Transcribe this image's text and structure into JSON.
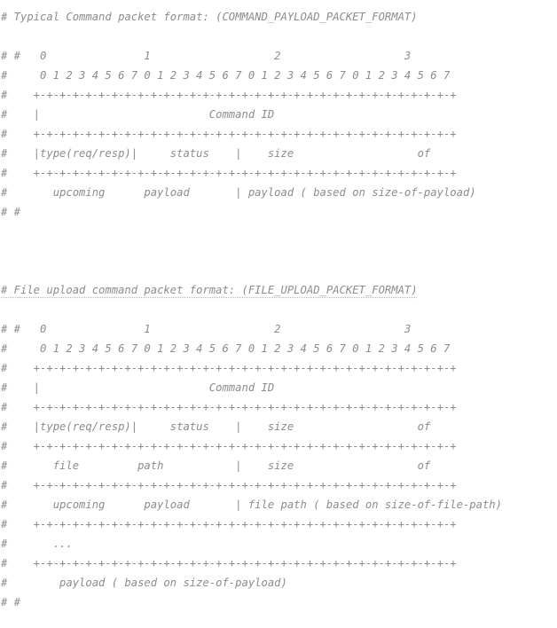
{
  "lines": [
    "# Typical Command packet format: (COMMAND_PAYLOAD_PACKET_FORMAT)",
    "",
    "# #   0               1                   2                   3",
    "#     0 1 2 3 4 5 6 7 0 1 2 3 4 5 6 7 0 1 2 3 4 5 6 7 0 1 2 3 4 5 6 7",
    "#    +-+-+-+-+-+-+-+-+-+-+-+-+-+-+-+-+-+-+-+-+-+-+-+-+-+-+-+-+-+-+-+-+",
    "#    |                          Command ID",
    "#    +-+-+-+-+-+-+-+-+-+-+-+-+-+-+-+-+-+-+-+-+-+-+-+-+-+-+-+-+-+-+-+-+",
    "#    |type(req/resp)|     status    |    size                   of",
    "#    +-+-+-+-+-+-+-+-+-+-+-+-+-+-+-+-+-+-+-+-+-+-+-+-+-+-+-+-+-+-+-+-+",
    "#       upcoming      payload       | payload ( based on size-of-payload)",
    "# #",
    "",
    "",
    "",
    "# File upload command packet format: (FILE_UPLOAD_PACKET_FORMAT)",
    "",
    "# #   0               1                   2                   3",
    "#     0 1 2 3 4 5 6 7 0 1 2 3 4 5 6 7 0 1 2 3 4 5 6 7 0 1 2 3 4 5 6 7",
    "#    +-+-+-+-+-+-+-+-+-+-+-+-+-+-+-+-+-+-+-+-+-+-+-+-+-+-+-+-+-+-+-+-+",
    "#    |                          Command ID",
    "#    +-+-+-+-+-+-+-+-+-+-+-+-+-+-+-+-+-+-+-+-+-+-+-+-+-+-+-+-+-+-+-+-+",
    "#    |type(req/resp)|     status    |    size                   of",
    "#    +-+-+-+-+-+-+-+-+-+-+-+-+-+-+-+-+-+-+-+-+-+-+-+-+-+-+-+-+-+-+-+-+",
    "#       file         path           |    size                   of",
    "#    +-+-+-+-+-+-+-+-+-+-+-+-+-+-+-+-+-+-+-+-+-+-+-+-+-+-+-+-+-+-+-+-+",
    "#       upcoming      payload       | file path ( based on size-of-file-path)",
    "#    +-+-+-+-+-+-+-+-+-+-+-+-+-+-+-+-+-+-+-+-+-+-+-+-+-+-+-+-+-+-+-+-+",
    "#       ...",
    "#    +-+-+-+-+-+-+-+-+-+-+-+-+-+-+-+-+-+-+-+-+-+-+-+-+-+-+-+-+-+-+-+-+",
    "#        payload ( based on size-of-payload)",
    "# #"
  ]
}
